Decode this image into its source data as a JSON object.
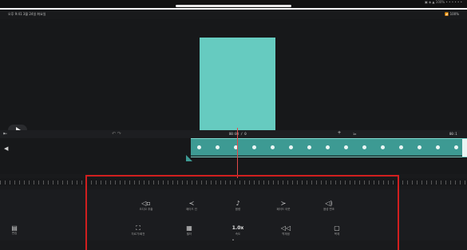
{
  "status_bar": {
    "left": "오후 9:41  3월 24일 화요일",
    "right": "📶 100%",
    "outer_right": "▣ ◈ ▲ 100% • • • • • •"
  },
  "timeline": {
    "current_time": "00:00 / 0",
    "end_time": "00:1",
    "speed_mini": "1x"
  },
  "tools_row1": [
    {
      "icon": "volume-icon",
      "glyph": "◁▫",
      "label": "오디오 추출"
    },
    {
      "icon": "fade-in-icon",
      "glyph": "≺",
      "label": "페이드 인"
    },
    {
      "icon": "audio-icon",
      "glyph": "♪",
      "label": "음량"
    },
    {
      "icon": "fade-out-icon",
      "glyph": "≻",
      "label": "페이드 아웃"
    },
    {
      "icon": "denoise-icon",
      "glyph": "◁)",
      "label": "음성 변조"
    }
  ],
  "tools_row2": [
    {
      "icon": "crop-icon",
      "glyph": "⛶",
      "label": "자르기/회전"
    },
    {
      "icon": "filter-icon",
      "glyph": "▦",
      "label": "필터"
    },
    {
      "icon": "speed-icon",
      "glyph": "1.0x",
      "label": "속도"
    },
    {
      "icon": "reverse-icon",
      "glyph": "◁◁",
      "label": "역재생"
    },
    {
      "icon": "snapshot-icon",
      "glyph": "▢",
      "label": "복제"
    }
  ],
  "bottom_left": {
    "glyph": "▤",
    "label": "편집"
  },
  "colors": {
    "clip": "#66cbc0",
    "track": "#3d9a93",
    "highlight": "#d11f1f",
    "playhead": "#e24a4a"
  }
}
